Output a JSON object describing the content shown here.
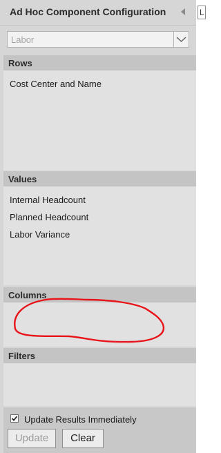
{
  "panel": {
    "title": "Ad Hoc Component Configuration"
  },
  "component_select": {
    "selected": "Labor"
  },
  "sections": {
    "rows": {
      "title": "Rows",
      "items": [
        "Cost Center and Name"
      ]
    },
    "values": {
      "title": "Values",
      "items": [
        "Internal Headcount",
        "Planned Headcount",
        "Labor Variance"
      ]
    },
    "columns": {
      "title": "Columns",
      "items": []
    },
    "filters": {
      "title": "Filters",
      "items": []
    }
  },
  "footer": {
    "checkbox_label": "Update Results Immediately",
    "checkbox_checked": true,
    "update_label": "Update",
    "clear_label": "Clear"
  },
  "side_field": {
    "text": "L"
  },
  "annotation": {
    "color": "#e8141a"
  }
}
